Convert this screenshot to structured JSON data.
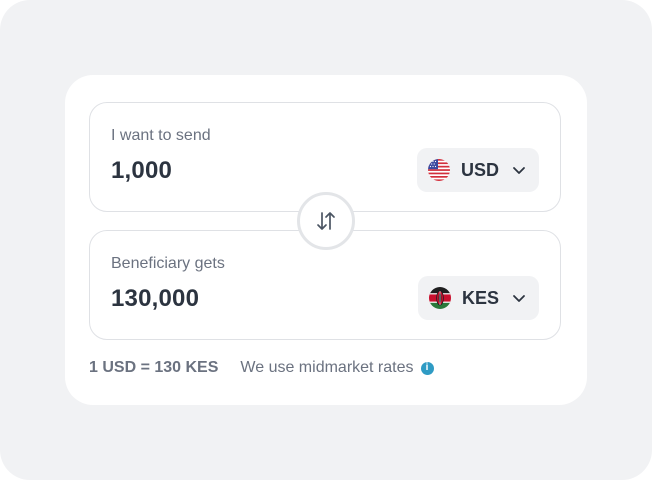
{
  "send": {
    "label": "I want to send",
    "amount": "1,000",
    "currency": {
      "code": "USD",
      "flag_icon": "us-flag-icon"
    }
  },
  "receive": {
    "label": "Beneficiary gets",
    "amount": "130,000",
    "currency": {
      "code": "KES",
      "flag_icon": "kenya-flag-icon"
    }
  },
  "swap": {
    "icon": "swap-vertical-arrows-icon"
  },
  "footer": {
    "rate": "1 USD = 130 KES",
    "note": "We use midmarket rates",
    "info_icon": "info-icon"
  },
  "colors": {
    "background": "#f1f2f4",
    "card": "#ffffff",
    "text_primary": "#2c3440",
    "text_secondary": "#6b7280",
    "info_accent": "#2f9bc4"
  }
}
